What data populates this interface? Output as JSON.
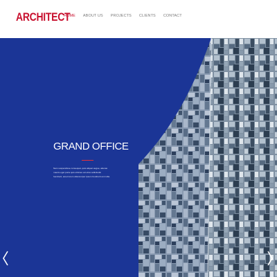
{
  "brand": {
    "logo_text": "ARCHITECT",
    "accent_color": "#c8102e"
  },
  "nav": {
    "items": [
      {
        "label": "HOME",
        "active": true
      },
      {
        "label": "ABOUT US",
        "active": false
      },
      {
        "label": "PROJECTS",
        "active": false
      },
      {
        "label": "CLIENTS",
        "active": false
      },
      {
        "label": "CONTACT",
        "active": false
      }
    ]
  },
  "hero": {
    "title": "GRAND OFFICE",
    "body": "Nam suspendisse consequat, quis aliquet augue, alienas mauris eget porta quis ultricies vel ellus sollicitudin hendrerit, amet lorem ullamcorper ipsum hendrerit est nulla.",
    "background_color": "#1b3596",
    "rule_color": "#e5313b"
  },
  "slider": {
    "prev_icon": "chevron-left-icon",
    "next_icon": "chevron-right-icon"
  }
}
